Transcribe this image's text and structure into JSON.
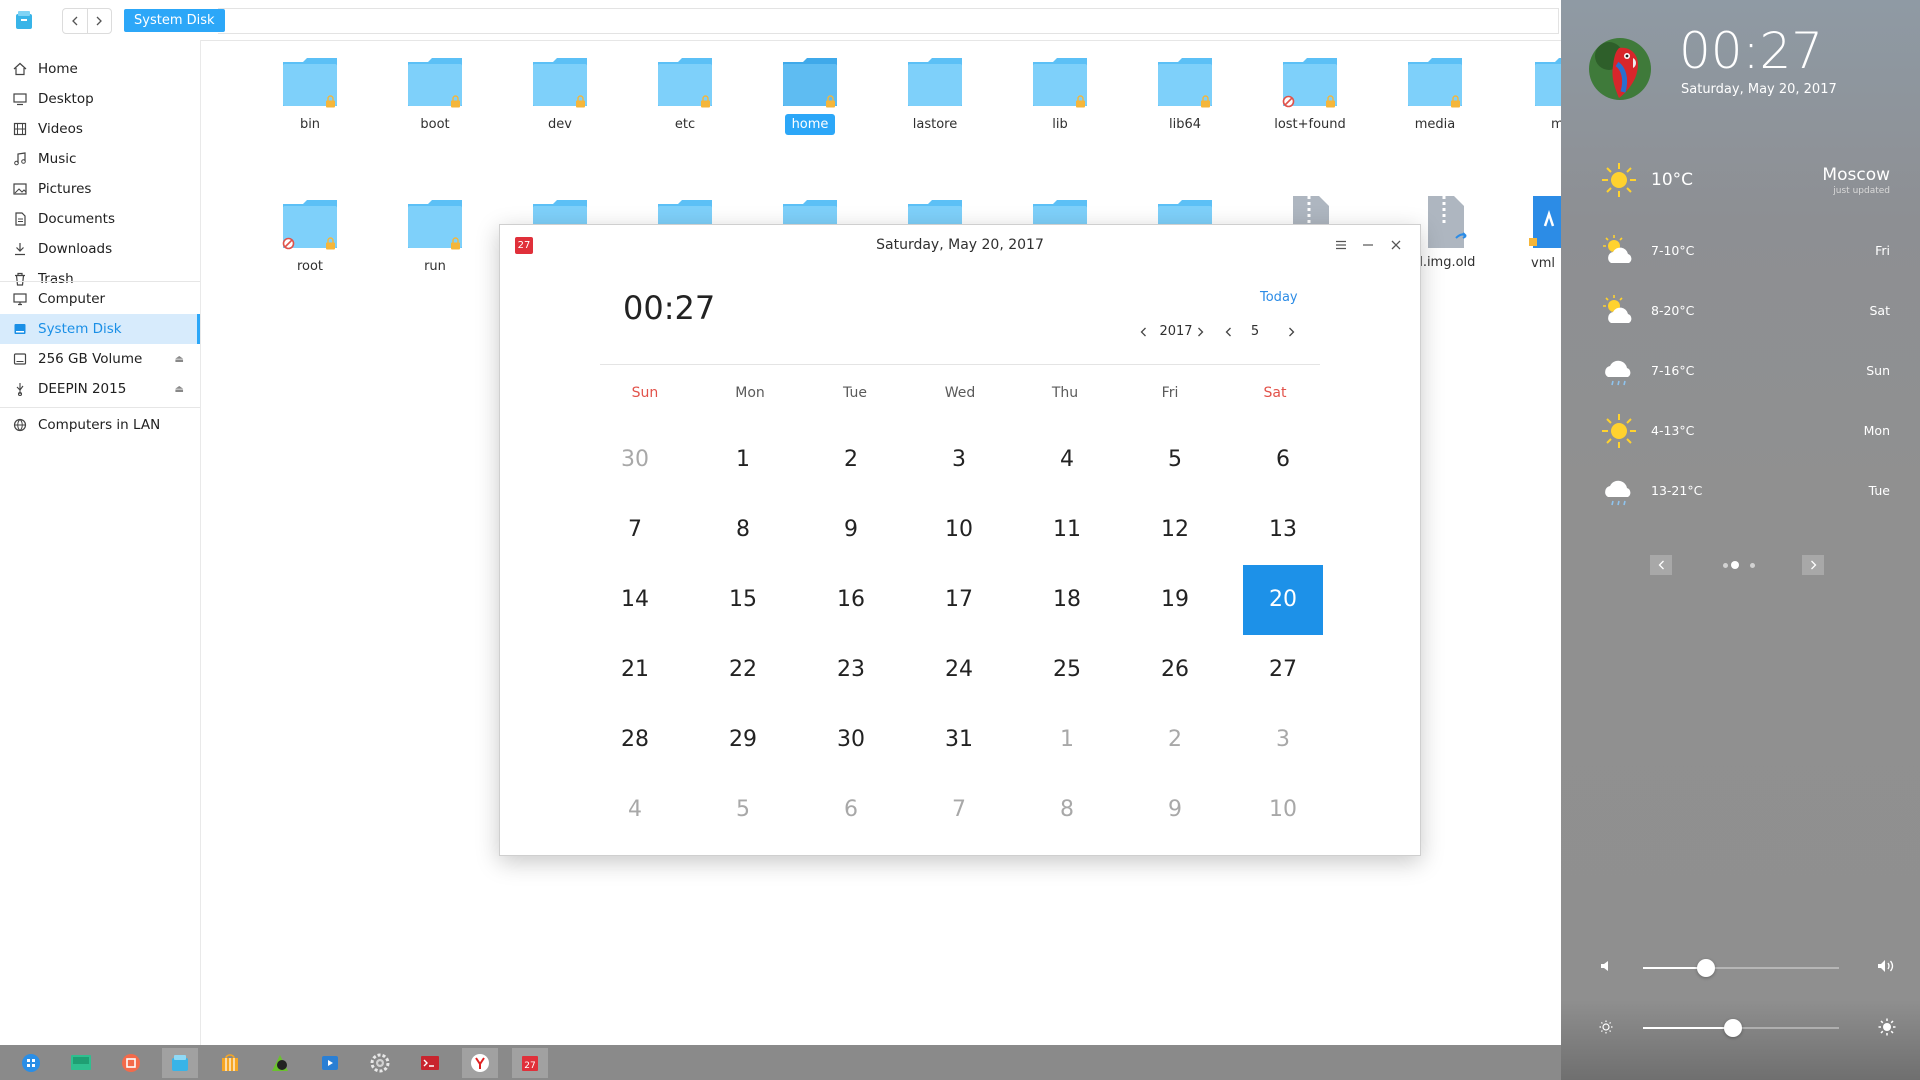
{
  "file_manager": {
    "breadcrumb": "System Disk",
    "sidebar": {
      "home": "Home",
      "desktop": "Desktop",
      "videos": "Videos",
      "music": "Music",
      "pictures": "Pictures",
      "documents": "Documents",
      "downloads": "Downloads",
      "trash": "Trash",
      "computer": "Computer",
      "system_disk": "System Disk",
      "volume": "256 GB Volume",
      "deepin": "DEEPIN 2015",
      "lan": "Computers in LAN"
    },
    "files": {
      "bin": "bin",
      "boot": "boot",
      "dev": "dev",
      "etc": "etc",
      "home": "home",
      "lastore": "lastore",
      "lib": "lib",
      "lib64": "lib64",
      "lost_found": "lost+found",
      "media": "media",
      "m_partial": "m",
      "root": "root",
      "run": "run",
      "img_old": "d.img.old",
      "vml_partial": "vml"
    },
    "colors": {
      "accent": "#2ca7f8",
      "folder": "#5cc0f6"
    }
  },
  "calendar": {
    "badge": "27",
    "title": "Saturday, May 20, 2017",
    "time": "00:27",
    "today_label": "Today",
    "year": "2017",
    "month": "5",
    "weekdays": [
      "Sun",
      "Mon",
      "Tue",
      "Wed",
      "Thu",
      "Fri",
      "Sat"
    ],
    "weeks": [
      [
        "30",
        "1",
        "2",
        "3",
        "4",
        "5",
        "6"
      ],
      [
        "7",
        "8",
        "9",
        "10",
        "11",
        "12",
        "13"
      ],
      [
        "14",
        "15",
        "16",
        "17",
        "18",
        "19",
        "20"
      ],
      [
        "21",
        "22",
        "23",
        "24",
        "25",
        "26",
        "27"
      ],
      [
        "28",
        "29",
        "30",
        "31",
        "1",
        "2",
        "3"
      ],
      [
        "4",
        "5",
        "6",
        "7",
        "8",
        "9",
        "10"
      ]
    ],
    "selected_day": "20"
  },
  "panel": {
    "clock": "00:27",
    "date": "Saturday, May 20, 2017",
    "weather": {
      "city": "Moscow",
      "updated": "just updated",
      "current_temp": "10°C",
      "current_icon": "sun-icon",
      "forecast": [
        {
          "temp": "7-10°C",
          "day": "Fri",
          "icon": "partly-cloudy-icon"
        },
        {
          "temp": "8-20°C",
          "day": "Sat",
          "icon": "partly-cloudy-icon"
        },
        {
          "temp": "7-16°C",
          "day": "Sun",
          "icon": "cloud-rain-icon"
        },
        {
          "temp": "4-13°C",
          "day": "Mon",
          "icon": "sun-icon"
        },
        {
          "temp": "13-21°C",
          "day": "Tue",
          "icon": "cloud-rain-icon"
        }
      ]
    },
    "volume_level": 0.32,
    "brightness_level": 0.46
  }
}
